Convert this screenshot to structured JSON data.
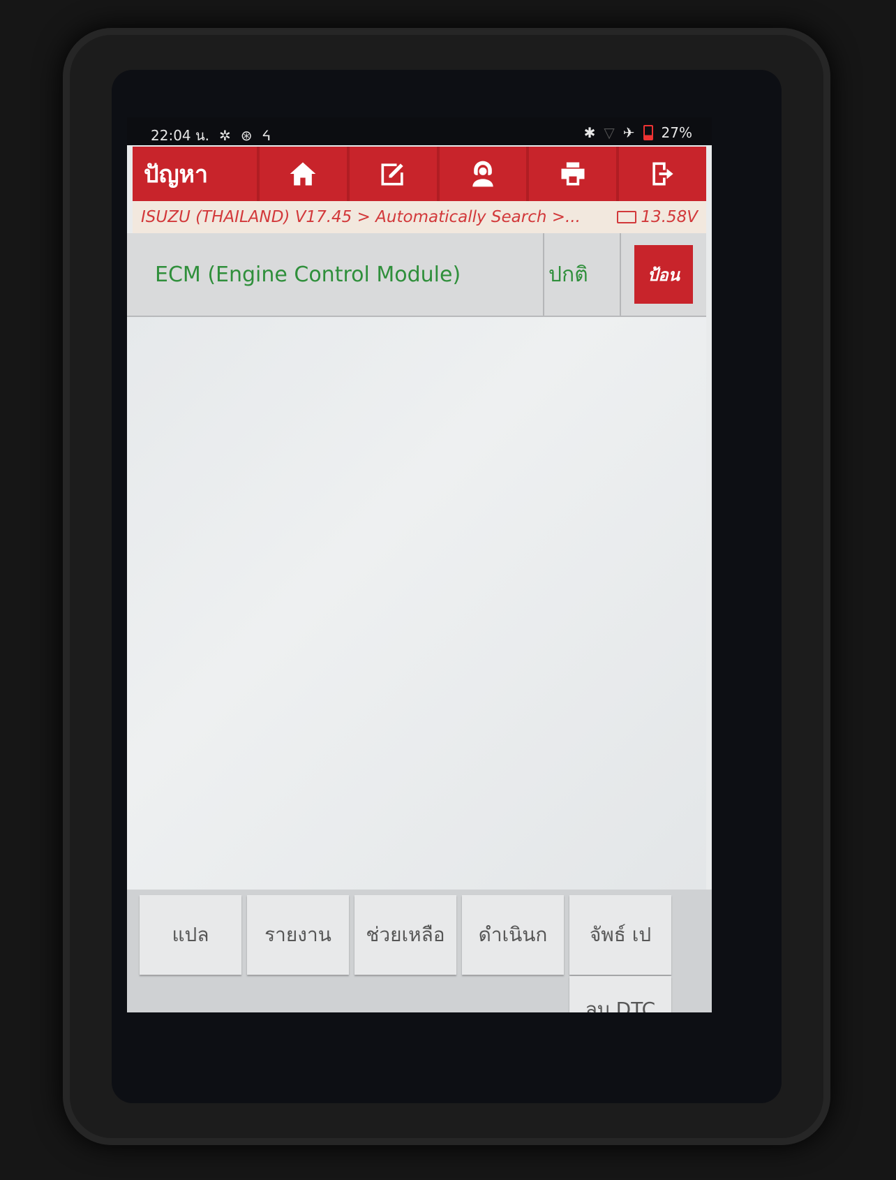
{
  "status_bar": {
    "time": "22:04 น.",
    "battery": "27%"
  },
  "toolbar": {
    "title": "ปัญหา",
    "buttons": [
      "home-icon",
      "edit-icon",
      "support-icon",
      "print-icon",
      "exit-icon"
    ]
  },
  "breadcrumb": {
    "path": "ISUZU (THAILAND) V17.45 > Automatically Search >...",
    "voltage": "13.58V"
  },
  "module": {
    "name": "ECM (Engine Control Module)",
    "status": "ปกติ",
    "enter_label": "ป้อน"
  },
  "bottom_buttons": [
    "แปล",
    "รายงาน",
    "ช่วยเหลือ",
    "ดำเนินก",
    "จัพธ์  เป",
    "ลบ DTC"
  ],
  "colors": {
    "accent": "#c8242b",
    "ok_text": "#2f8f3b"
  }
}
